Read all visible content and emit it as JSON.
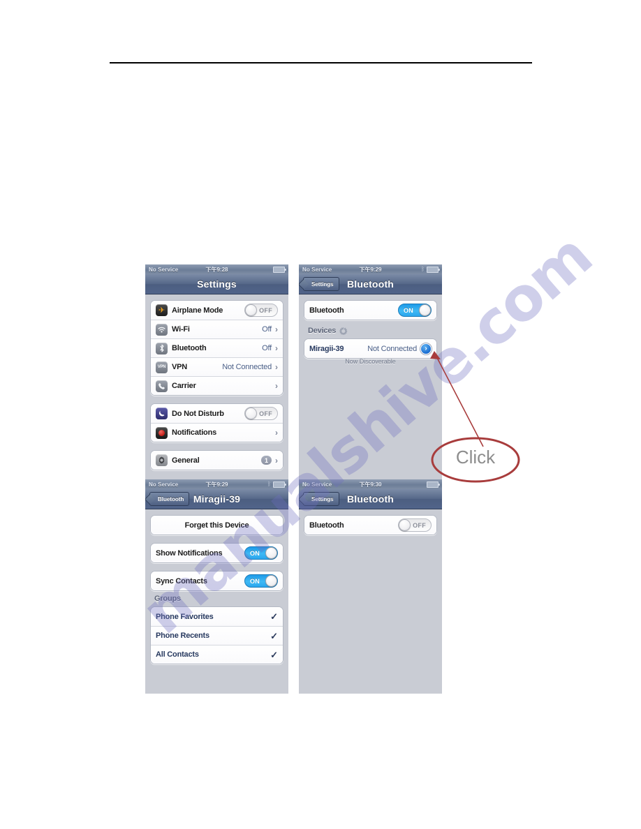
{
  "screens": {
    "settings": {
      "status": {
        "carrier": "No Service",
        "time": "下午9:28",
        "battery_icon": "battery-icon"
      },
      "nav": {
        "title": "Settings"
      },
      "groups": [
        {
          "rows": [
            {
              "icon": "airplane-icon",
              "label": "Airplane Mode",
              "control": "switch",
              "switch_state": "OFF"
            },
            {
              "icon": "wifi-icon",
              "label": "Wi-Fi",
              "value": "Off",
              "control": "chevron"
            },
            {
              "icon": "bluetooth-icon",
              "label": "Bluetooth",
              "value": "Off",
              "control": "chevron"
            },
            {
              "icon": "vpn-icon",
              "label": "VPN",
              "value": "Not Connected",
              "control": "chevron"
            },
            {
              "icon": "carrier-icon",
              "label": "Carrier",
              "value": "",
              "control": "chevron"
            }
          ]
        },
        {
          "rows": [
            {
              "icon": "moon-icon",
              "label": "Do Not Disturb",
              "control": "switch",
              "switch_state": "OFF"
            },
            {
              "icon": "notifications-icon",
              "label": "Notifications",
              "value": "",
              "control": "chevron"
            }
          ]
        },
        {
          "rows": [
            {
              "icon": "gear-icon",
              "label": "General",
              "badge": "1",
              "control": "chevron"
            }
          ]
        }
      ]
    },
    "bluetooth_on": {
      "status": {
        "carrier": "No Service",
        "time": "下午9:29",
        "bluetooth_icon": "bluetooth-status-icon",
        "battery_icon": "battery-icon"
      },
      "nav": {
        "back_label": "Settings",
        "title": "Bluetooth"
      },
      "toggle_row": {
        "label": "Bluetooth",
        "switch_state": "ON"
      },
      "section_header": "Devices",
      "device_row": {
        "name": "Miragii-39",
        "status": "Not Connected",
        "disclosure": "chevron-right-circle-icon"
      },
      "caption": "Now Discoverable"
    },
    "device_detail": {
      "status": {
        "carrier": "No Service",
        "time": "下午9:29",
        "bluetooth_icon": "bluetooth-status-icon",
        "battery_icon": "battery-icon"
      },
      "nav": {
        "back_label": "Bluetooth",
        "title": "Miragii-39"
      },
      "forget_button": "Forget this Device",
      "toggles": [
        {
          "label": "Show Notifications",
          "switch_state": "ON"
        },
        {
          "label": "Sync Contacts",
          "switch_state": "ON"
        }
      ],
      "section_header": "Groups",
      "groups": [
        {
          "label": "Phone Favorites",
          "checked": "✓"
        },
        {
          "label": "Phone Recents",
          "checked": "✓"
        },
        {
          "label": "All Contacts",
          "checked": "✓"
        }
      ]
    },
    "bluetooth_off": {
      "status": {
        "carrier": "No Service",
        "time": "下午9:30",
        "battery_icon": "battery-icon"
      },
      "nav": {
        "back_label": "Settings",
        "title": "Bluetooth"
      },
      "toggle_row": {
        "label": "Bluetooth",
        "switch_state": "OFF"
      }
    }
  },
  "annotation": {
    "label": "Click",
    "ellipse_color": "#a83c3c",
    "arrow_color": "#a83c3c",
    "text_color": "#8d8d8d"
  },
  "watermark": {
    "text": "manualshive.com",
    "color": "#6c6cbe"
  },
  "icons": {
    "airplane": "✈",
    "wifi": "◕",
    "bluetooth": "ᛒ",
    "vpn": "VPN",
    "phone": "✆",
    "moon": "☾",
    "gear": "✴",
    "chevron": "›",
    "disclosure_chevron": "›"
  }
}
